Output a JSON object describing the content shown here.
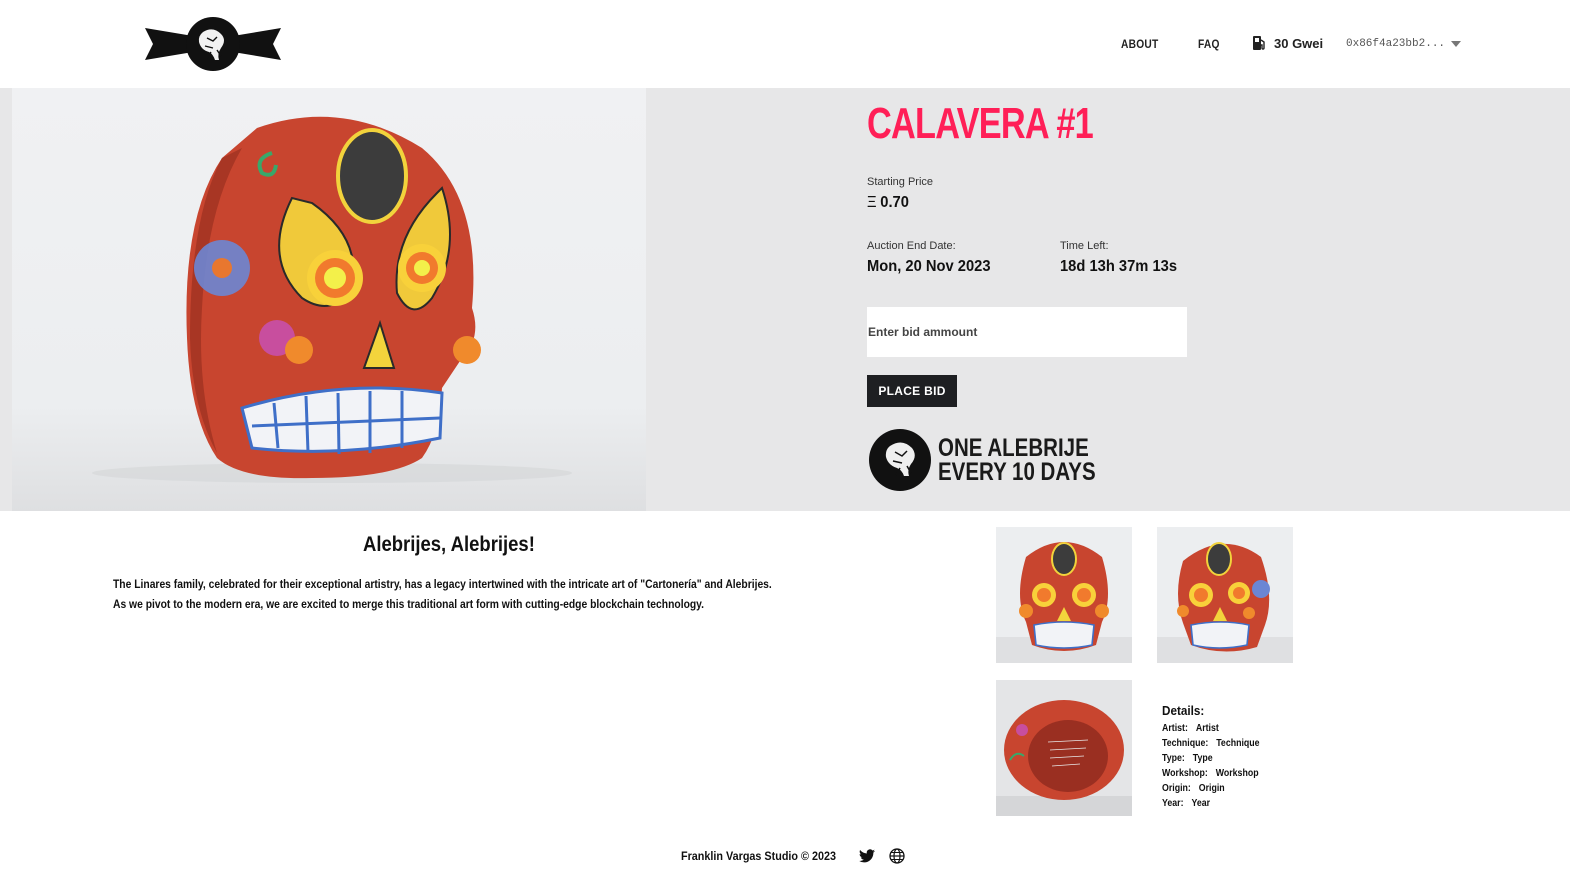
{
  "header": {
    "nav": [
      "ABOUT",
      "FAQ"
    ],
    "gas_label": "30 Gwei",
    "wallet_address": "0x86f4a23bb2..."
  },
  "auction": {
    "title": "CALAVERA #1",
    "starting_price_label": "Starting Price",
    "currency_symbol": "Ξ",
    "starting_price": "0.70",
    "end_date_label": "Auction End Date:",
    "end_date": "Mon, 20 Nov 2023",
    "time_left_label": "Time Left:",
    "time_left": "18d 13h 37m 13s",
    "bid_placeholder": "Enter bid ammount",
    "bid_button": "PLACE BID",
    "promo_line1": "ONE ALEBRIJE",
    "promo_line2": "EVERY 10 DAYS"
  },
  "story": {
    "title": "Alebrijes, Alebrijes!",
    "body": "The Linares family, celebrated for their exceptional artistry, has a legacy intertwined with the intricate art of \"Cartonería\" and Alebrijes. As we pivot to the modern era, we are excited to merge this traditional art form with cutting-edge blockchain technology."
  },
  "details": {
    "heading": "Details:",
    "rows": [
      {
        "key": "Artist:",
        "value": "Artist"
      },
      {
        "key": "Technique:",
        "value": "Technique"
      },
      {
        "key": "Type:",
        "value": "Type"
      },
      {
        "key": "Workshop:",
        "value": "Workshop"
      },
      {
        "key": "Origin:",
        "value": "Origin"
      },
      {
        "key": "Year:",
        "value": "Year"
      }
    ]
  },
  "footer": {
    "copyright": "Franklin Vargas Studio © 2023"
  },
  "colors": {
    "accent": "#ff1f57",
    "hero_bg": "#e7e7e8",
    "button_bg": "#1e1f22",
    "skull_red": "#c8452f"
  }
}
